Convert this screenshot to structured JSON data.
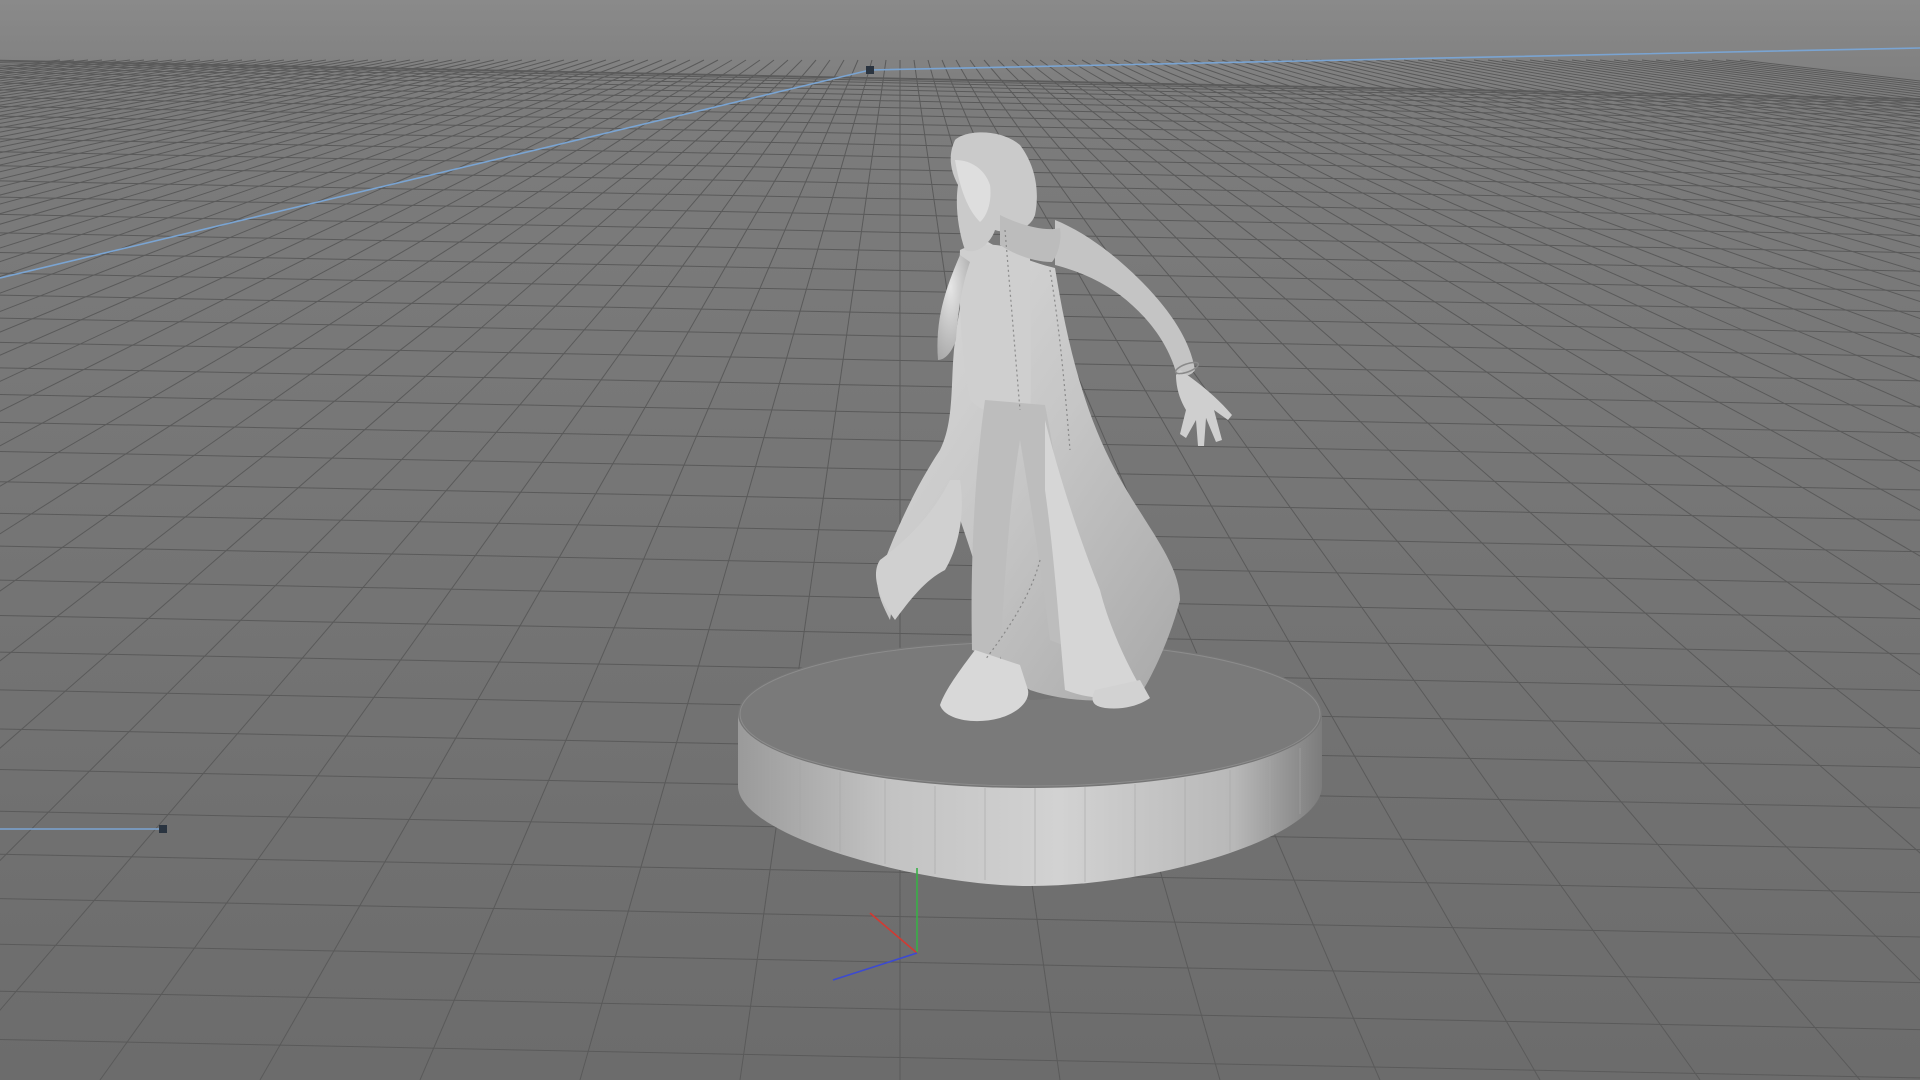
{
  "viewport": {
    "colors": {
      "background_top": "#858585",
      "background_bottom": "#6a6a6a",
      "grid_line": "#5a5a5a",
      "spline": "#7aa4d2",
      "model": "#c8c8c8",
      "base": "#b4b4b4",
      "axis_x": "#d23a32",
      "axis_y": "#38b046",
      "axis_z": "#3c4ad2"
    },
    "objects": {
      "figure": "figure-model",
      "base": "pedestal-base",
      "spline": "spline-path",
      "axis_gizmo": "world-axis"
    }
  }
}
